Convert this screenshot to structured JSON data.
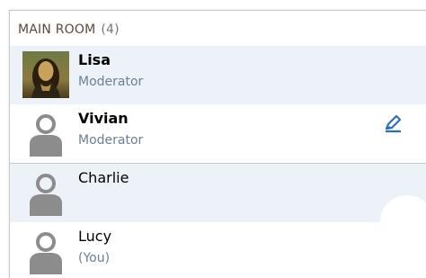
{
  "room": {
    "title": "MAIN ROOM",
    "count": "(4)"
  },
  "participants": [
    {
      "name": "Lisa",
      "role": "Moderator",
      "avatar": "portrait-photo"
    },
    {
      "name": "Vivian",
      "role": "Moderator",
      "avatar": "person-icon",
      "action_icon": "pencil-edit-icon"
    },
    {
      "name": "Charlie",
      "role": "",
      "avatar": "person-icon"
    },
    {
      "name": "Lucy",
      "role": "(You)",
      "avatar": "person-icon"
    }
  ],
  "colors": {
    "header_text": "#5a4a3d",
    "row_highlight": "#edf2f9",
    "role_text": "#6a7f94",
    "avatar_gray": "#8c8c8c",
    "edit_blue": "#2a6fc0"
  }
}
